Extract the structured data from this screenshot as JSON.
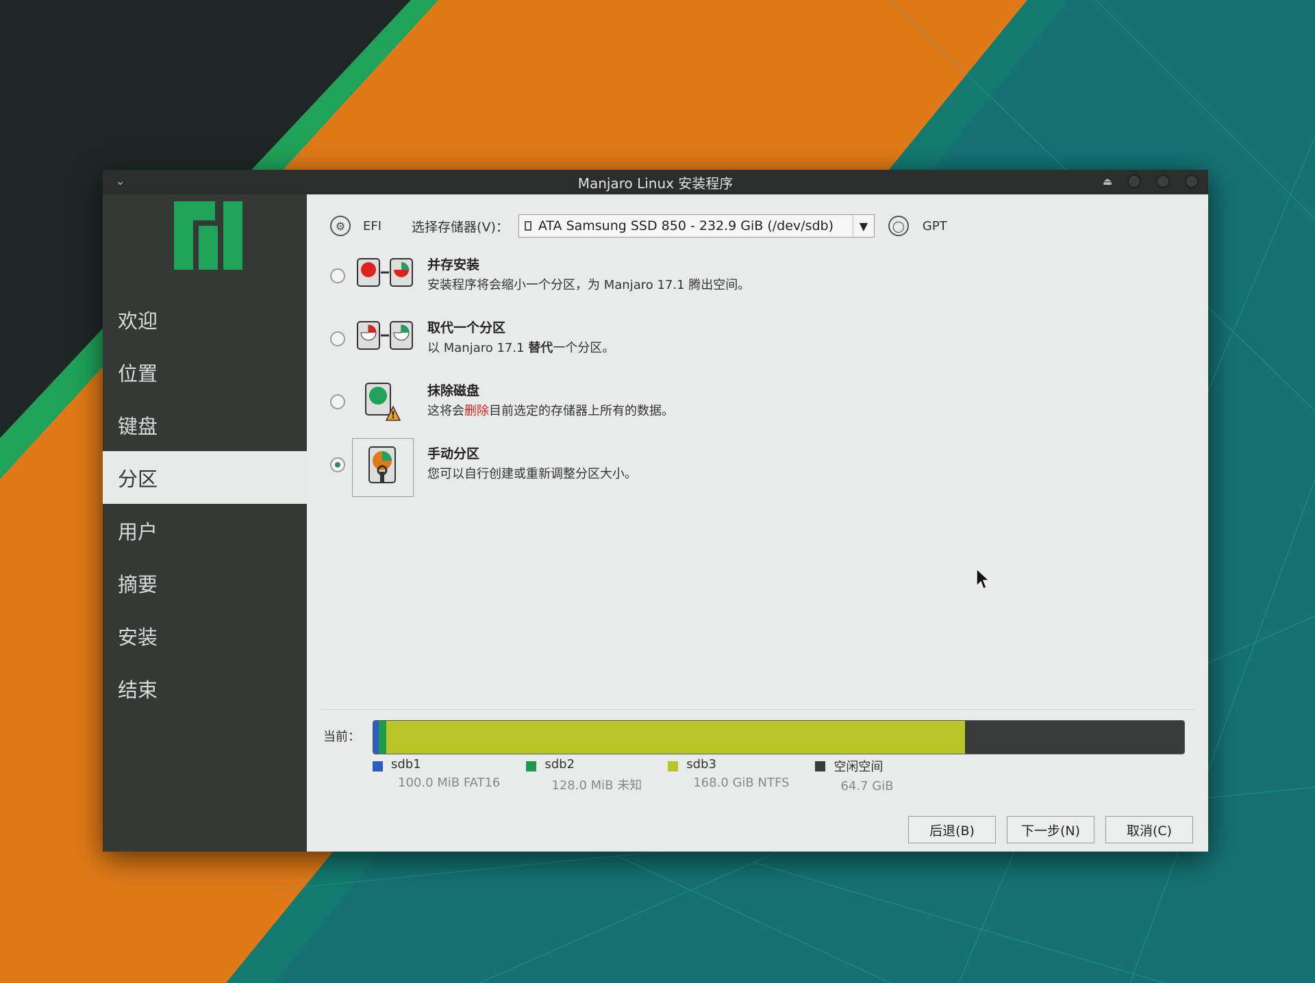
{
  "window": {
    "title": "Manjaro Linux 安装程序"
  },
  "sidebar": {
    "items": [
      {
        "label": "欢迎",
        "active": false
      },
      {
        "label": "位置",
        "active": false
      },
      {
        "label": "键盘",
        "active": false
      },
      {
        "label": "分区",
        "active": true
      },
      {
        "label": "用户",
        "active": false
      },
      {
        "label": "摘要",
        "active": false
      },
      {
        "label": "安装",
        "active": false
      },
      {
        "label": "结束",
        "active": false
      }
    ]
  },
  "topbar": {
    "efi_label": "EFI",
    "device_label": "选择存储器(V)：",
    "device_value": "ATA Samsung SSD 850 - 232.9 GiB (/dev/sdb)",
    "table_type": "GPT"
  },
  "options": [
    {
      "title": "并存安装",
      "desc_parts": [
        "安装程序将会缩小一个分区，为 Manjaro 17.1 腾出空间。"
      ],
      "checked": false,
      "icon": "alongside-disks-icon"
    },
    {
      "title": "取代一个分区",
      "desc_parts": [
        "以 Manjaro 17.1 ",
        "替代",
        "一个分区。"
      ],
      "checked": false,
      "icon": "replace-disks-icon"
    },
    {
      "title": "抹除磁盘",
      "desc_parts": [
        "这将会",
        "删除",
        "目前选定的存储器上所有的数据。"
      ],
      "checked": false,
      "icon": "erase-disk-warning-icon"
    },
    {
      "title": "手动分区",
      "desc_parts": [
        "您可以自行创建或重新调整分区大小。"
      ],
      "checked": true,
      "icon": "manual-partition-icon"
    }
  ],
  "current": {
    "label": "当前：",
    "partitions": [
      {
        "name": "sdb1",
        "info": "100.0 MiB  FAT16",
        "color": "#2a5dbf",
        "fraction": 0.007
      },
      {
        "name": "sdb2",
        "info": "128.0 MiB  未知",
        "color": "#1f9a4a",
        "fraction": 0.009
      },
      {
        "name": "sdb3",
        "info": "168.0 GiB  NTFS",
        "color": "#b9c627",
        "fraction": 0.714
      },
      {
        "name": "空闲空间",
        "info": "64.7 GiB",
        "color": "#3a3c3b",
        "fraction": 0.27
      }
    ]
  },
  "buttons": {
    "back": "后退(B)",
    "next": "下一步(N)",
    "cancel": "取消(C)"
  },
  "colors": {
    "accent": "#1f9a4a",
    "sidebar_bg": "#343936",
    "danger": "#e02020"
  }
}
